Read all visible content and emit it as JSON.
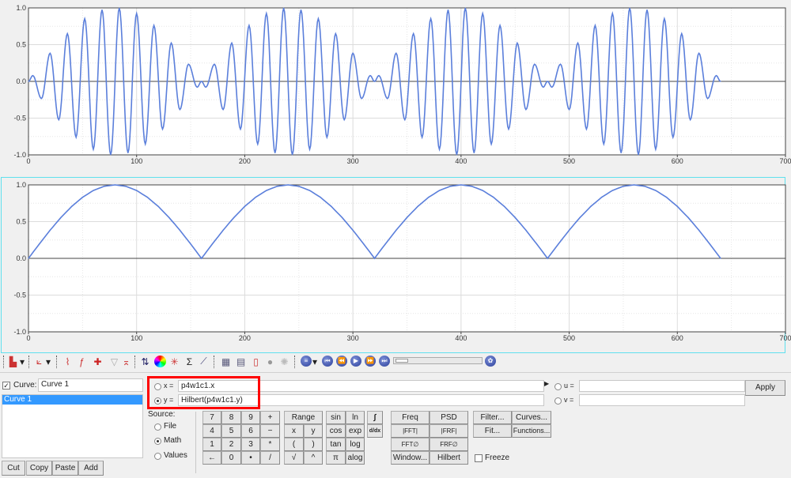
{
  "chart_data": [
    {
      "type": "line",
      "xlim": [
        0,
        700
      ],
      "ylim": [
        -1,
        1
      ],
      "xticks": [
        "0",
        "100",
        "200",
        "300",
        "400",
        "500",
        "600",
        "700"
      ],
      "yticks": [
        "-1.0",
        "-0.5",
        "0.0",
        "0.5",
        "1.0"
      ],
      "grid": true,
      "color": "#5b7fdb",
      "x": [
        0,
        4,
        12,
        20,
        28,
        36,
        44,
        52,
        60,
        68,
        76,
        84,
        92,
        100,
        108,
        116,
        124,
        132,
        140,
        148,
        156,
        160,
        164,
        172,
        180,
        188,
        196,
        204,
        212,
        220,
        228,
        236,
        244,
        252,
        260,
        268,
        276,
        284,
        292,
        300,
        308,
        316,
        320,
        324,
        332,
        340,
        348,
        356,
        364,
        372,
        380,
        388,
        396,
        404,
        412,
        420,
        428,
        436,
        444,
        452,
        460,
        468,
        476,
        480,
        484,
        492,
        500,
        508,
        516,
        524,
        532,
        540,
        548,
        556,
        564,
        572,
        580,
        588,
        596,
        604,
        612,
        620,
        628,
        636,
        640
      ],
      "y": [
        0,
        0.078,
        -0.233,
        0.383,
        -0.522,
        0.649,
        -0.76,
        0.853,
        -0.924,
        0.972,
        -0.997,
        0.997,
        -0.972,
        0.924,
        -0.853,
        0.76,
        -0.649,
        0.522,
        -0.383,
        0.233,
        -0.078,
        0,
        -0.078,
        0.233,
        -0.383,
        0.522,
        -0.649,
        0.76,
        -0.853,
        0.924,
        -0.972,
        0.997,
        -0.997,
        0.972,
        -0.924,
        0.853,
        -0.76,
        0.649,
        -0.522,
        0.383,
        -0.233,
        0.078,
        0,
        0.078,
        -0.233,
        0.383,
        -0.522,
        0.649,
        -0.76,
        0.853,
        -0.924,
        0.972,
        -0.997,
        0.997,
        -0.972,
        0.924,
        -0.853,
        0.76,
        -0.649,
        0.522,
        -0.383,
        0.233,
        -0.078,
        0,
        -0.078,
        0.233,
        -0.383,
        0.522,
        -0.649,
        0.76,
        -0.853,
        0.924,
        -0.972,
        0.997,
        -0.997,
        0.972,
        -0.924,
        0.853,
        -0.76,
        0.649,
        -0.522,
        0.383,
        -0.233,
        0.078,
        0
      ]
    },
    {
      "type": "line",
      "xlim": [
        0,
        700
      ],
      "ylim": [
        -1,
        1
      ],
      "xticks": [
        "0",
        "100",
        "200",
        "300",
        "400",
        "500",
        "600",
        "700"
      ],
      "yticks": [
        "-1.0",
        "-0.5",
        "0.0",
        "0.5",
        "1.0"
      ],
      "grid": true,
      "color": "#5b7fdb",
      "x": [
        0,
        10,
        20,
        30,
        40,
        50,
        60,
        70,
        80,
        90,
        100,
        110,
        120,
        130,
        140,
        150,
        160,
        170,
        180,
        190,
        200,
        210,
        220,
        230,
        240,
        250,
        260,
        270,
        280,
        290,
        300,
        310,
        320,
        330,
        340,
        350,
        360,
        370,
        380,
        390,
        400,
        410,
        420,
        430,
        440,
        450,
        460,
        470,
        480,
        490,
        500,
        510,
        520,
        530,
        540,
        550,
        560,
        570,
        580,
        590,
        600,
        610,
        620,
        630,
        640
      ],
      "y": [
        0,
        0.195,
        0.383,
        0.556,
        0.707,
        0.831,
        0.924,
        0.981,
        1,
        0.981,
        0.924,
        0.831,
        0.707,
        0.556,
        0.383,
        0.195,
        0,
        0.195,
        0.383,
        0.556,
        0.707,
        0.831,
        0.924,
        0.981,
        1,
        0.981,
        0.924,
        0.831,
        0.707,
        0.556,
        0.383,
        0.195,
        0,
        0.195,
        0.383,
        0.556,
        0.707,
        0.831,
        0.924,
        0.981,
        1,
        0.981,
        0.924,
        0.831,
        0.707,
        0.556,
        0.383,
        0.195,
        0,
        0.195,
        0.383,
        0.556,
        0.707,
        0.831,
        0.924,
        0.981,
        1,
        0.981,
        0.924,
        0.831,
        0.707,
        0.556,
        0.383,
        0.195,
        0
      ]
    }
  ],
  "curve_panel": {
    "curve_label": "Curve:",
    "curve_name": "Curve 1",
    "curve_checked": true,
    "list_items": [
      "Curve 1"
    ],
    "buttons": {
      "cut": "Cut",
      "copy": "Copy",
      "paste": "Paste",
      "add": "Add"
    }
  },
  "expressions": {
    "x_label": "x =",
    "x_value": "p4w1c1.x",
    "y_label": "y =",
    "y_value": "Hilbert(p4w1c1.y)",
    "u_label": "u =",
    "u_value": "",
    "v_label": "v =",
    "v_value": "",
    "selected": "y",
    "apply": "Apply"
  },
  "source": {
    "label": "Source:",
    "options": [
      "File",
      "Math",
      "Values"
    ],
    "selected": "Math"
  },
  "keypad": [
    [
      "7",
      "8",
      "9",
      "+"
    ],
    [
      "4",
      "5",
      "6",
      "−"
    ],
    [
      "1",
      "2",
      "3",
      "*"
    ],
    [
      "←",
      "0",
      "•",
      "/"
    ]
  ],
  "functions": {
    "range": "Range",
    "x": "x",
    "y": "y",
    "lparen": "(",
    "rparen": ")",
    "sqrt": "√",
    "pow": "^",
    "sin": "sin",
    "ln": "ln",
    "cos": "cos",
    "exp": "exp",
    "tan": "tan",
    "log": "log",
    "pi": "π",
    "alog": "alog",
    "integral": "∫",
    "derivative": "d/dx",
    "freq": "Freq",
    "psd": "PSD",
    "fft": "|FFT|",
    "frf": "|FRF|",
    "fft_phase": "FFT∅",
    "frf_phase": "FRF∅",
    "window": "Window...",
    "hilbert": "Hilbert",
    "filter": "Filter...",
    "curves": "Curves...",
    "fit": "Fit...",
    "functions": "Functions...",
    "freeze": "Freeze",
    "freeze_checked": false
  },
  "accent": {
    "highlight": "#3399ff",
    "callout": "#ff0000",
    "plot_border": "#5fe0ee"
  }
}
